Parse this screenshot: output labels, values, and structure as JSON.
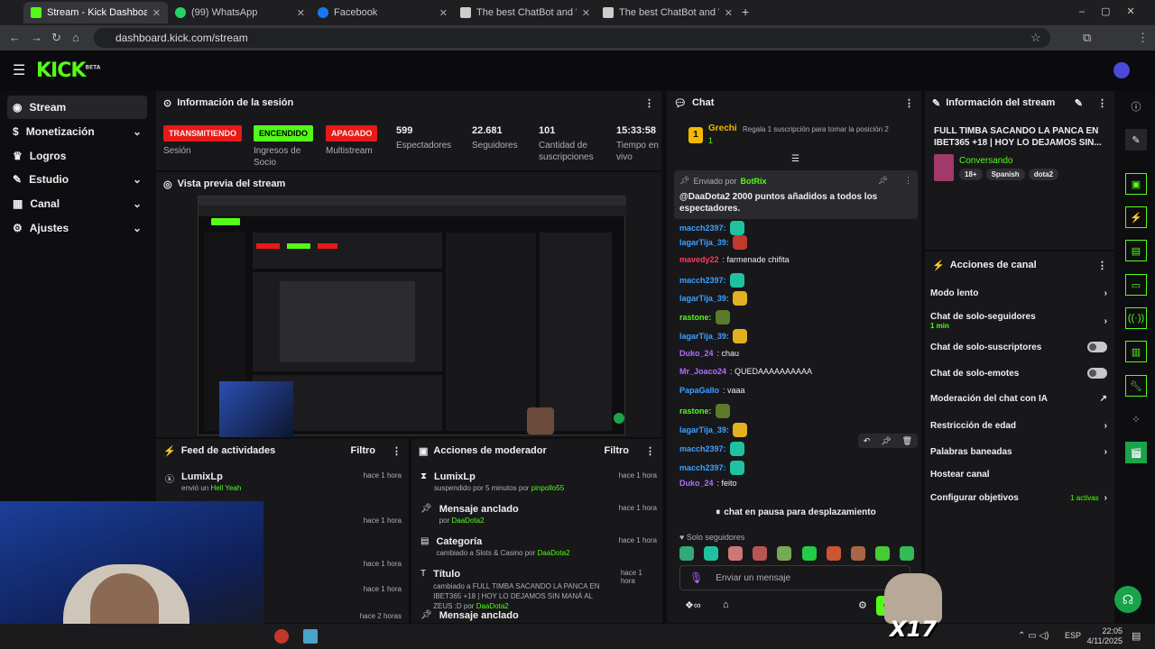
{
  "browser": {
    "tabs": [
      {
        "title": "Stream - Kick Dashboard",
        "color": "#53fc18"
      },
      {
        "title": "(99) WhatsApp",
        "color": "#25d366"
      },
      {
        "title": "Facebook",
        "color": "#1877f2"
      },
      {
        "title": "The best ChatBot and Widgets",
        "color": "#cccccc"
      },
      {
        "title": "The best ChatBot and Widgets",
        "color": "#cccccc"
      }
    ],
    "url": "dashboard.kick.com/stream"
  },
  "header": {
    "logo": "KICK",
    "logo_sup": "BETA"
  },
  "sidebar": {
    "items": [
      {
        "label": "Stream",
        "icon": "live-icon"
      },
      {
        "label": "Monetización",
        "icon": "dollar-icon"
      },
      {
        "label": "Logros",
        "icon": "trophy-icon"
      },
      {
        "label": "Estudio",
        "icon": "brush-icon"
      },
      {
        "label": "Canal",
        "icon": "grid-icon"
      },
      {
        "label": "Ajustes",
        "icon": "gear-icon"
      }
    ]
  },
  "session": {
    "title": "Información de la sesión",
    "stats": [
      {
        "badge": "TRANSMITIENDO",
        "label": "Sesión"
      },
      {
        "badge": "ENCENDIDO",
        "label": "Ingresos de Socio"
      },
      {
        "badge": "APAGADO",
        "label": "Multistream"
      },
      {
        "value": "599",
        "label": "Espectadores"
      },
      {
        "value": "22.681",
        "label": "Seguidores"
      },
      {
        "value": "101",
        "label": "Cantidad de suscripciones"
      },
      {
        "value": "15:33:58",
        "label": "Tiempo en vivo"
      }
    ]
  },
  "preview": {
    "title": "Vista previa del stream"
  },
  "feed": {
    "title": "Feed de actividades",
    "filter": "Filtro",
    "items": [
      {
        "who": "LumixLp",
        "action": "envió un",
        "target": "Hell Yeah",
        "time": "hace 1 hora"
      },
      {
        "who": "",
        "action": "",
        "target": "",
        "time": "hace 1 hora"
      },
      {
        "who": "",
        "action": "",
        "target": "",
        "time": "hace 1 hora"
      },
      {
        "who": "",
        "action": "",
        "target": "",
        "time": "hace 1 hora"
      },
      {
        "who": "",
        "action": "",
        "target": "",
        "time": "hace 2 horas"
      }
    ]
  },
  "mod": {
    "title": "Acciones de moderador",
    "filter": "Filtro",
    "items": [
      {
        "icon": "hourglass-icon",
        "who": "LumixLp",
        "sub": "suspendido por 5 minutos por",
        "by": "pinpollo55",
        "time": "hace 1 hora"
      },
      {
        "icon": "pin-icon",
        "who": "Mensaje anclado",
        "sub": "por",
        "by": "DaaDota2",
        "time": "hace 1 hora"
      },
      {
        "icon": "category-icon",
        "who": "Categoría",
        "sub": "cambiado a Slots & Casino por",
        "by": "DaaDota2",
        "time": "hace 1 hora"
      },
      {
        "icon": "title-icon",
        "who": "Título",
        "sub": "cambiado a FULL TIMBA SACANDO LA PANCA EN IBET365 +18 | HOY LO DEJAMOS SIN MANÁ AL ZEUS :D por",
        "by": "DaaDota2",
        "time": "hace 1 hora"
      },
      {
        "icon": "pin-icon",
        "who": "Mensaje anclado",
        "sub": "",
        "by": "",
        "time": ""
      }
    ]
  },
  "chat": {
    "title": "Chat",
    "top_gifter": "Grechi",
    "top_gifter_count": "1",
    "gift_prompt": "Regala 1 suscripción para tomar la posición 2",
    "pinned_by": "Enviado por",
    "pinned_user": "BotRix",
    "pinned_msg": "@DaaDota2 2000 puntos añadidos a todos los espectadores.",
    "messages": [
      {
        "user": "macch2397:",
        "text": "",
        "color": "#3ea0ff"
      },
      {
        "user": "lagarTija_39:",
        "text": "",
        "color": "#3ea0ff"
      },
      {
        "user": "mavedy22",
        "text": ": farmenade chifita",
        "color": "#ff3b5c"
      },
      {
        "user": "macch2397:",
        "text": "",
        "color": "#3ea0ff"
      },
      {
        "user": "lagarTija_39:",
        "text": "",
        "color": "#3ea0ff"
      },
      {
        "user": "rastone:",
        "text": "",
        "color": "#53fc18"
      },
      {
        "user": "lagarTija_39:",
        "text": "",
        "color": "#3ea0ff"
      },
      {
        "user": "Duko_24",
        "text": ": chau",
        "color": "#b36bff"
      },
      {
        "user": "Mr_Joaco24",
        "text": ": QUEDAAAAAAAAAA",
        "color": "#b36bff"
      },
      {
        "user": "PapaGallo",
        "text": ": vaaa",
        "color": "#3ea0ff"
      },
      {
        "user": "rastone:",
        "text": "",
        "color": "#53fc18"
      },
      {
        "user": "lagarTija_39:",
        "text": "",
        "color": "#3ea0ff"
      },
      {
        "user": "macch2397:",
        "text": "",
        "color": "#3ea0ff"
      },
      {
        "user": "macch2397:",
        "text": "",
        "color": "#3ea0ff"
      },
      {
        "user": "Duko_24",
        "text": ": feito",
        "color": "#b36bff"
      }
    ],
    "paused": "chat en pausa para desplazamiento",
    "followers_only": "Solo seguidores",
    "input_placeholder": "Enviar un mensaje",
    "send_label": "Ch"
  },
  "stream_info": {
    "title": "Información del stream",
    "stream_title": "FULL TIMBA SACANDO LA PANCA EN IBET365 +18 | HOY LO DEJAMOS SIN...",
    "category": "Conversando",
    "tags": [
      "18+",
      "Spanish",
      "dota2"
    ]
  },
  "channel_actions": {
    "title": "Acciones de canal",
    "rows": [
      {
        "label": "Modo lento",
        "sub": "",
        "control": "chevron"
      },
      {
        "label": "Chat de solo-seguidores",
        "sub": "1 min",
        "control": "chevron"
      },
      {
        "label": "Chat de solo-suscriptores",
        "sub": "",
        "control": "toggle"
      },
      {
        "label": "Chat de solo-emotes",
        "sub": "",
        "control": "toggle"
      },
      {
        "label": "Moderación del chat con IA",
        "sub": "",
        "control": "external"
      },
      {
        "label": "Restricción de edad",
        "sub": "",
        "control": "chevron"
      },
      {
        "label": "Palabras baneadas",
        "sub": "",
        "control": "chevron"
      },
      {
        "label": "Hostear canal",
        "sub": "",
        "control": "none"
      },
      {
        "label": "Configurar objetivos",
        "sub": "1 activas",
        "control": "chevron"
      }
    ]
  },
  "taskbar": {
    "lang": "ESP",
    "time": "22:05",
    "date": "4/11/2025"
  },
  "overlay": {
    "multiplier": "X17"
  }
}
